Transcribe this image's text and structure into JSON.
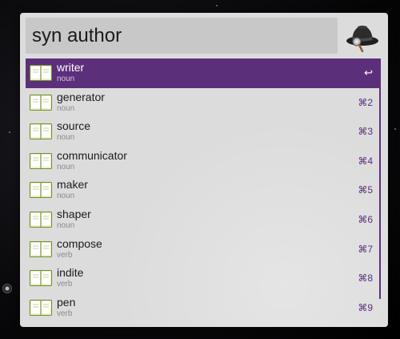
{
  "search": {
    "query": "syn author"
  },
  "app": {
    "icon": "alfred-hat-icon"
  },
  "colors": {
    "selection": "#5c2f7b",
    "window": "#dcdcdc",
    "search_bar": "#c8c8c8"
  },
  "results": [
    {
      "title": "writer",
      "subtitle": "noun",
      "shortcut": "↩",
      "icon": "dictionary-book-icon"
    },
    {
      "title": "generator",
      "subtitle": "noun",
      "shortcut": "⌘2",
      "icon": "dictionary-book-icon"
    },
    {
      "title": "source",
      "subtitle": "noun",
      "shortcut": "⌘3",
      "icon": "dictionary-book-icon"
    },
    {
      "title": "communicator",
      "subtitle": "noun",
      "shortcut": "⌘4",
      "icon": "dictionary-book-icon"
    },
    {
      "title": "maker",
      "subtitle": "noun",
      "shortcut": "⌘5",
      "icon": "dictionary-book-icon"
    },
    {
      "title": "shaper",
      "subtitle": "noun",
      "shortcut": "⌘6",
      "icon": "dictionary-book-icon"
    },
    {
      "title": "compose",
      "subtitle": "verb",
      "shortcut": "⌘7",
      "icon": "dictionary-book-icon"
    },
    {
      "title": "indite",
      "subtitle": "verb",
      "shortcut": "⌘8",
      "icon": "dictionary-book-icon"
    },
    {
      "title": "pen",
      "subtitle": "verb",
      "shortcut": "⌘9",
      "icon": "dictionary-book-icon"
    }
  ]
}
